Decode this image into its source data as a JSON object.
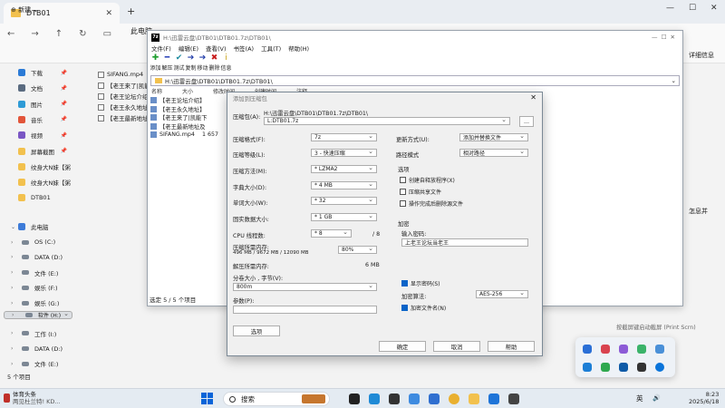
{
  "explorer": {
    "tab_title": "DTB01",
    "breadcrumb": "此电脑",
    "new_label": "新建",
    "details_label": "详细信息",
    "right_clip": "怎息并",
    "status": "5 个项目",
    "quick_access": [
      {
        "label": "下载",
        "color": "#2b7bd6"
      },
      {
        "label": "文档",
        "color": "#5a6b80"
      },
      {
        "label": "图片",
        "color": "#2e9bd6"
      },
      {
        "label": "音乐",
        "color": "#e2553a"
      },
      {
        "label": "视频",
        "color": "#7a56c4"
      },
      {
        "label": "屏幕截图",
        "color": "#f2c14e"
      },
      {
        "label": "纹身大N妹【粥",
        "color": "#f2c14e"
      },
      {
        "label": "纹身大N妹【粥",
        "color": "#f2c14e"
      },
      {
        "label": "DTB01",
        "color": "#f2c14e"
      }
    ],
    "this_pc": "此电脑",
    "drives": [
      "OS (C:)",
      "DATA (D:)",
      "文件 (E:)",
      "娱乐 (F:)",
      "娱乐 (G:)",
      "软件 (H:)",
      "工作 (I:)",
      "DATA (D:)",
      "文件 (E:)"
    ],
    "files": [
      "SIFANG.mp4",
      "【老王来了|凯能",
      "【老王论坛介绍",
      "【老王永久地址",
      "【老王最新地址"
    ]
  },
  "sevenzip": {
    "title": "H:\\迅雷云盘\\DTB01\\DTB01.7z\\DTB01\\",
    "menu": [
      "文件(F)",
      "编辑(E)",
      "查看(V)",
      "书签(A)",
      "工具(T)",
      "帮助(H)"
    ],
    "tools": [
      {
        "label": "添加",
        "glyph": "✚",
        "color": "#1e9e2e"
      },
      {
        "label": "解压",
        "glyph": "━",
        "color": "#2740b8"
      },
      {
        "label": "测试",
        "glyph": "✔",
        "color": "#1d8a9e"
      },
      {
        "label": "复制",
        "glyph": "➔",
        "color": "#1f3aa8"
      },
      {
        "label": "移动",
        "glyph": "➔",
        "color": "#1f3aa8"
      },
      {
        "label": "删除",
        "glyph": "✖",
        "color": "#c81e1e"
      },
      {
        "label": "信息",
        "glyph": "i",
        "color": "#c9a215"
      }
    ],
    "path": "H:\\迅雷云盘\\DTB01\\DTB01.7z\\DTB01\\",
    "columns": [
      "名称",
      "大小",
      "修改时间",
      "创建时间",
      "注释"
    ],
    "rows": [
      {
        "name": "【老王论坛介绍】",
        "size": ""
      },
      {
        "name": "【老王永久地址】",
        "size": ""
      },
      {
        "name": "【老王来了|凯能下",
        "size": ""
      },
      {
        "name": "【老王最新地址及",
        "size": ""
      },
      {
        "name": "SIFANG.mp4",
        "size": "1 657"
      }
    ],
    "footer": "选定 5 / 5 个项目"
  },
  "dialog": {
    "title": "添加到压缩包",
    "archive_label": "压缩包(A):",
    "archive_dir": "H:\\迅雷云盘\\DTB01\\DTB01.7z\\DTB01\\",
    "archive_name": "L:DTB01.7z",
    "browse": "...",
    "format_label": "压缩格式(F):",
    "format_value": "7z",
    "level_label": "压缩等级(L):",
    "level_value": "3 - 快速压缩",
    "method_label": "压缩方法(M):",
    "method_value": "* LZMA2",
    "dict_label": "字典大小(D):",
    "dict_value": "* 4 MB",
    "word_label": "单词大小(W):",
    "word_value": "* 32",
    "solid_label": "固实数据大小:",
    "solid_value": "* 1 GB",
    "threads_label": "CPU 线程数:",
    "threads_value": "* 8",
    "threads_max": "/ 8",
    "mem_label": "压缩所需内存:",
    "mem_detail": "496 MB / 9672 MB / 12090 MB",
    "mem_percent": "80%",
    "decomp_label": "解压所需内存:",
    "decomp_value": "6 MB",
    "split_label": "分卷大小 , 字节(V):",
    "split_value": "800m",
    "params_label": "参数(P):",
    "options_button": "选项",
    "update_label": "更新方式(U):",
    "update_value": "添加并替换文件",
    "pathmode_label": "路径模式",
    "pathmode_value": "相对路径",
    "options_group": "选项",
    "opt1": "创建自释放程序(X)",
    "opt2": "压缩共享文件",
    "opt3": "操作完成后删除源文件",
    "encrypt_group": "加密",
    "pwd_label": "输入密码:",
    "pwd_value": "上老王论坛当老王",
    "show_pwd": "显示密码(S)",
    "enc_method_label": "加密算法:",
    "enc_method_value": "AES-256",
    "enc_names": "加密文件名(N)",
    "ok": "确定",
    "cancel": "取消",
    "help": "帮助"
  },
  "tray": {
    "note": "按截屏键启动截屏 (Print Scrn)"
  },
  "taskbar": {
    "news_title": "体育头条",
    "news_sub": "两见杜兰特! KD...",
    "search": "搜索",
    "ime": "英",
    "time": "8:23",
    "date": "2025/6/18"
  }
}
